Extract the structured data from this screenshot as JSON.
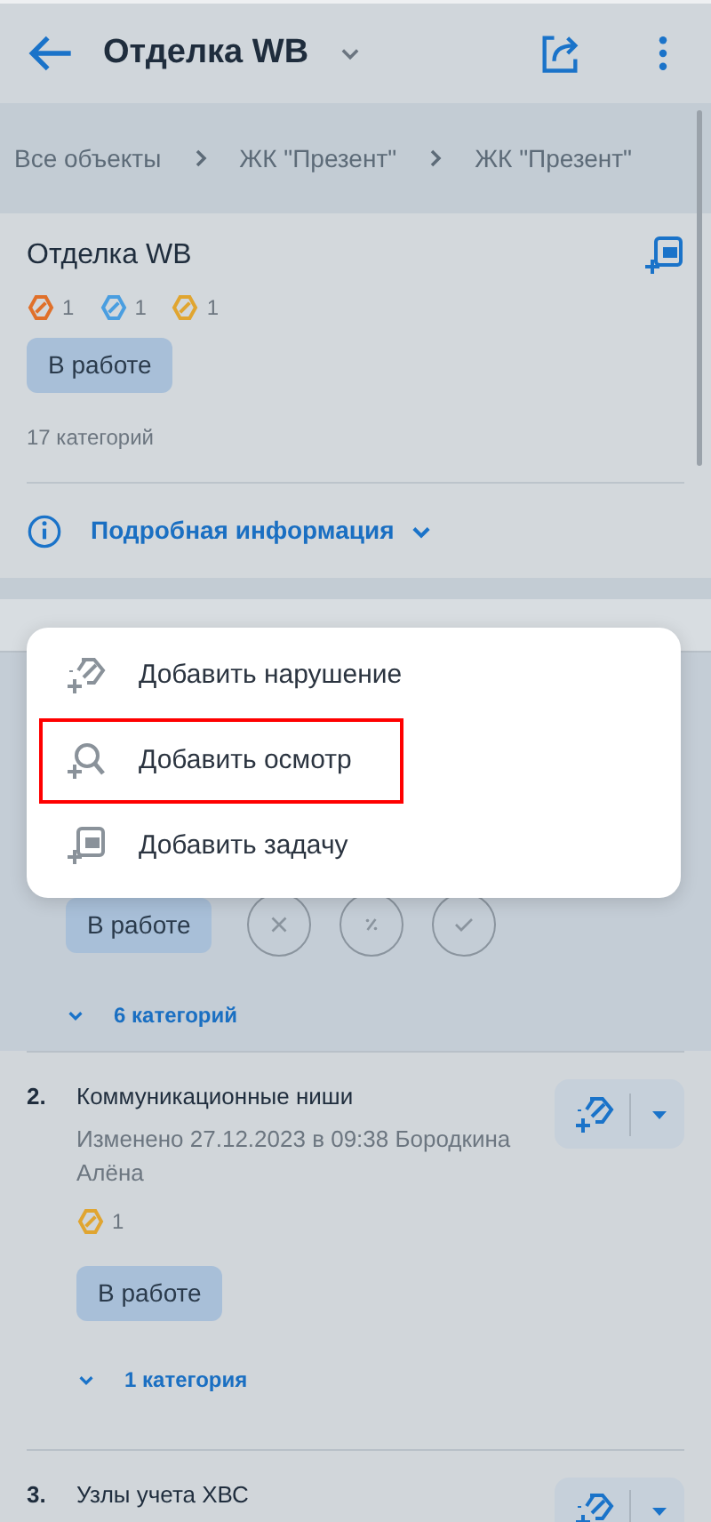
{
  "header": {
    "title": "Отделка WB"
  },
  "breadcrumbs": [
    {
      "label": "Все объекты"
    },
    {
      "label": "ЖК \"Презент\""
    },
    {
      "label": "ЖК \"Презент\""
    }
  ],
  "object": {
    "title": "Отделка WB",
    "counters": [
      {
        "color": "#e0702a",
        "count": "1"
      },
      {
        "color": "#4a9ee0",
        "count": "1"
      },
      {
        "color": "#e0a530",
        "count": "1"
      }
    ],
    "status": "В работе",
    "categories": "17 категорий",
    "details_label": "Подробная информация",
    "details_expanded": false
  },
  "first_item": {
    "status": "В работе",
    "actions": [
      {
        "kind": "reject"
      },
      {
        "kind": "percent"
      },
      {
        "kind": "accept"
      }
    ],
    "categories": "6 категорий",
    "expanded": false
  },
  "items": [
    {
      "number": "2.",
      "title": "Коммуникационные ниши",
      "meta": "Изменено 27.12.2023 в 09:38 Бородкина Алёна",
      "counters": [
        {
          "color": "#e0a530",
          "count": "1"
        }
      ],
      "status": "В работе",
      "categories": "1 категория",
      "expanded": false
    },
    {
      "number": "3.",
      "title": "Узлы учета ХВС"
    }
  ],
  "menu": {
    "items": [
      {
        "kind": "violation",
        "label": "Добавить нарушение",
        "highlighted": false
      },
      {
        "kind": "inspection",
        "label": "Добавить осмотр",
        "highlighted": true
      },
      {
        "kind": "task",
        "label": "Добавить задачу",
        "highlighted": false
      }
    ]
  }
}
